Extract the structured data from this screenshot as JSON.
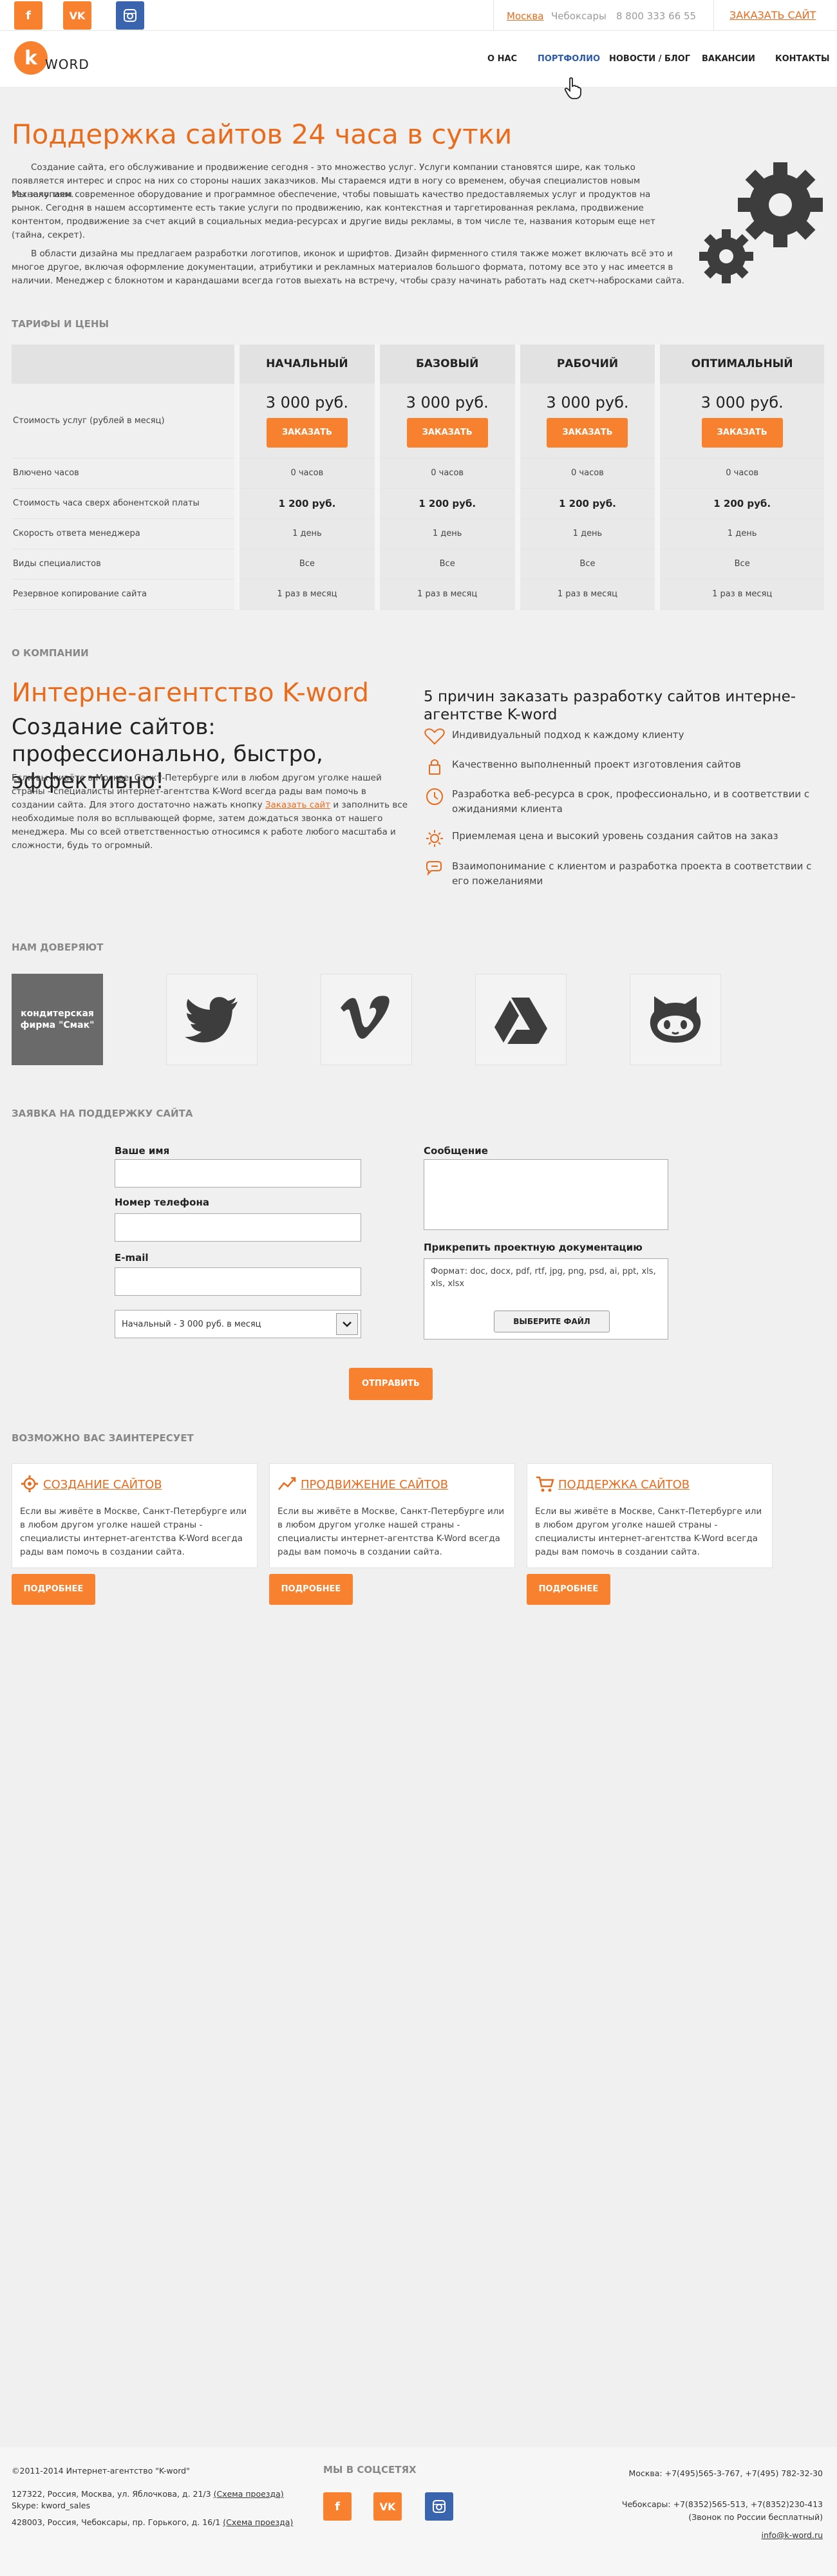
{
  "topbar": {
    "social": [
      "f",
      "VK",
      "ig"
    ],
    "cities": [
      "Москва",
      "Чебоксары"
    ],
    "phone": "8 800 333 66 55",
    "order_link": "ЗАКАЗАТЬ САЙТ"
  },
  "header": {
    "logo_letter": "k",
    "logo_word": "WORD",
    "nav": [
      "О НАС",
      "ПОРТФОЛИО",
      "НОВОСТИ / БЛОГ",
      "ВАКАНСИИ",
      "КОНТАКТЫ"
    ]
  },
  "hero": {
    "title": "Поддержка сайтов 24 часа в сутки",
    "p1": "Создание сайта, его обслуживание и продвижение сегодня - это множество услуг. Услуги компании становятся шире, как только появляется интерес и спрос на них со стороны наших заказчиков. Мы стараемся идти в ногу со временем, обучая специалистов новым технологиям.",
    "p2": "Мы закупаем современное оборудование и программное обеспечение, чтобы повышать качество предоставляемых услуг и продуктов на рынок. Сегодня в нашем ассортименте есть такие услуги по продвижению, как контекстная и таргетированная реклама, продвижение контентом, продвижение за счет акций в социальных медиа-ресурсах и другие виды рекламы, в том числе те, названия которым еще нет (тайна, секрет).",
    "p3": "В области дизайна мы предлагаем разработки логотипов, иконок и шрифтов. Дизайн фирменного стиля также может включать всё это и многое другое, включая оформление документации, атрибутики и рекламных материалов большого формата, потому все это у нас имеется в наличии. Менеджер с блокнотом и карандашами всегда готов выехать на встречу, чтобы сразу начинать работать над скетч-набросками сайта."
  },
  "pricing": {
    "section_title": "ТАРИФЫ И ЦЕНЫ",
    "plans": [
      "НАЧАЛЬНЫЙ",
      "БАЗОВЫЙ",
      "РАБОЧИЙ",
      "ОПТИМАЛЬНЫЙ"
    ],
    "order_label": "ЗАКАЗАТЬ",
    "rows": [
      {
        "label": "Стоимость услуг (рублей в месяц)",
        "values": [
          "3 000 руб.",
          "3 000 руб.",
          "3 000 руб.",
          "3 000 руб."
        ]
      },
      {
        "label": "Влючено часов",
        "values": [
          "0 часов",
          "0 часов",
          "0 часов",
          "0 часов"
        ]
      },
      {
        "label": "Стоимость часа сверх абонентской платы",
        "values": [
          "1 200 руб.",
          "1 200 руб.",
          "1 200 руб.",
          "1 200 руб."
        ]
      },
      {
        "label": "Скорость ответа менеджера",
        "values": [
          "1 день",
          "1 день",
          "1 день",
          "1 день"
        ]
      },
      {
        "label": "Виды специалистов",
        "values": [
          "Все",
          "Все",
          "Все",
          "Все"
        ]
      },
      {
        "label": "Резервное копирование сайта",
        "values": [
          "1 раз в месяц",
          "1 раз в месяц",
          "1 раз в месяц",
          "1 раз в месяц"
        ]
      }
    ]
  },
  "company": {
    "section_title": "О КОМПАНИИ",
    "title": "Интерне-агентство K-word",
    "subtitle": "Создание сайтов: профессионально, быстро, эффективно!",
    "text_before_link": "Если вы живёте в Москве, Санкт-Петербурге или в любом другом уголке нашей страны - специалисты интернет-агентства K-Word всегда рады вам помочь в создании сайта. Для этого достаточно нажать кнопку ",
    "link": "Заказать сайт",
    "text_after_link": " и заполнить все необходимые поля во всплывающей форме, затем дождаться звонка от нашего менеджера. Мы со всей ответственностью относимся к работе любого масштаба и сложности, будь то огромный.",
    "reasons_title": "5 причин заказать разработку сайтов интерне-агентстве K-word",
    "reasons": [
      "Индивидуальный подход к каждому клиенту",
      "Качественно выполненный проект изготовления сайтов",
      "Разработка веб-ресурса в срок, профессионально, и в соответствии с ожиданиями клиента",
      "Приемлемая цена и высокий уровень создания сайтов на заказ",
      "Взаимопонимание с клиентом и разработка проекта в соответствии с его пожеланиями"
    ]
  },
  "trust": {
    "section_title": "НАМ ДОВЕРЯЮТ",
    "first_label": "кондитерская фирма \"Смак\"",
    "logos": [
      "twitter-icon",
      "vimeo-icon",
      "google-drive-icon",
      "github-icon"
    ]
  },
  "form": {
    "section_title": "ЗАЯВКА НА ПОДДЕРЖКУ САЙТА",
    "name_label": "Ваше имя",
    "phone_label": "Номер телефона",
    "email_label": "E-mail",
    "tariff_selected": "Начальный - 3 000 руб. в месяц",
    "message_label": "Сообщение",
    "attach_label": "Прикрепить проектную документацию",
    "formats": "Формат: doc, docx, pdf, rtf, jpg, png, psd, ai, ppt, xls, xls, xlsx",
    "file_button": "ВЫБЕРИТЕ ФАЙЛ",
    "submit": "ОТПРАВИТЬ"
  },
  "interest": {
    "section_title": "ВОЗМОЖНО ВАС ЗАИНТЕРЕСУЕТ",
    "card_text": "Если вы живёте в Москве, Санкт-Петербурге или в любом другом уголке нашей страны - специалисты интернет-агентства K-Word всегда рады вам помочь в создании сайта.",
    "more": "ПОДРОБНЕЕ",
    "cards": [
      "СОЗДАНИЕ САЙТОВ",
      "ПРОДВИЖЕНИЕ САЙТОВ",
      "ПОДДЕРЖКА САЙТОВ"
    ]
  },
  "footer": {
    "copyright": "©2011-2014 Интернет-агентство \"K-word\"",
    "address1": "127322, Россия, Москва, ул. Яблочкова, д. 21/3",
    "address2": "428003, Россия, Чебоксары, пр. Горького, д. 16/1",
    "map_link": "(Схема проезда)",
    "skype": "Skype: kword_sales",
    "social_title": "МЫ В СОЦСЕТЯХ",
    "moscow_phones": "Москва: +7(495)565-3-767, +7(495) 782-32-30",
    "cheb_phones": "Чебоксары: +7(8352)565-513, +7(8352)230-413",
    "free_call": "(Звонок по России бесплатный)",
    "email": "info@k-word.ru"
  },
  "colors": {
    "accent": "#f7812e",
    "accent_text": "#e96b1c",
    "nav_active": "#2d5aa8",
    "instagram": "#3a64ad"
  }
}
